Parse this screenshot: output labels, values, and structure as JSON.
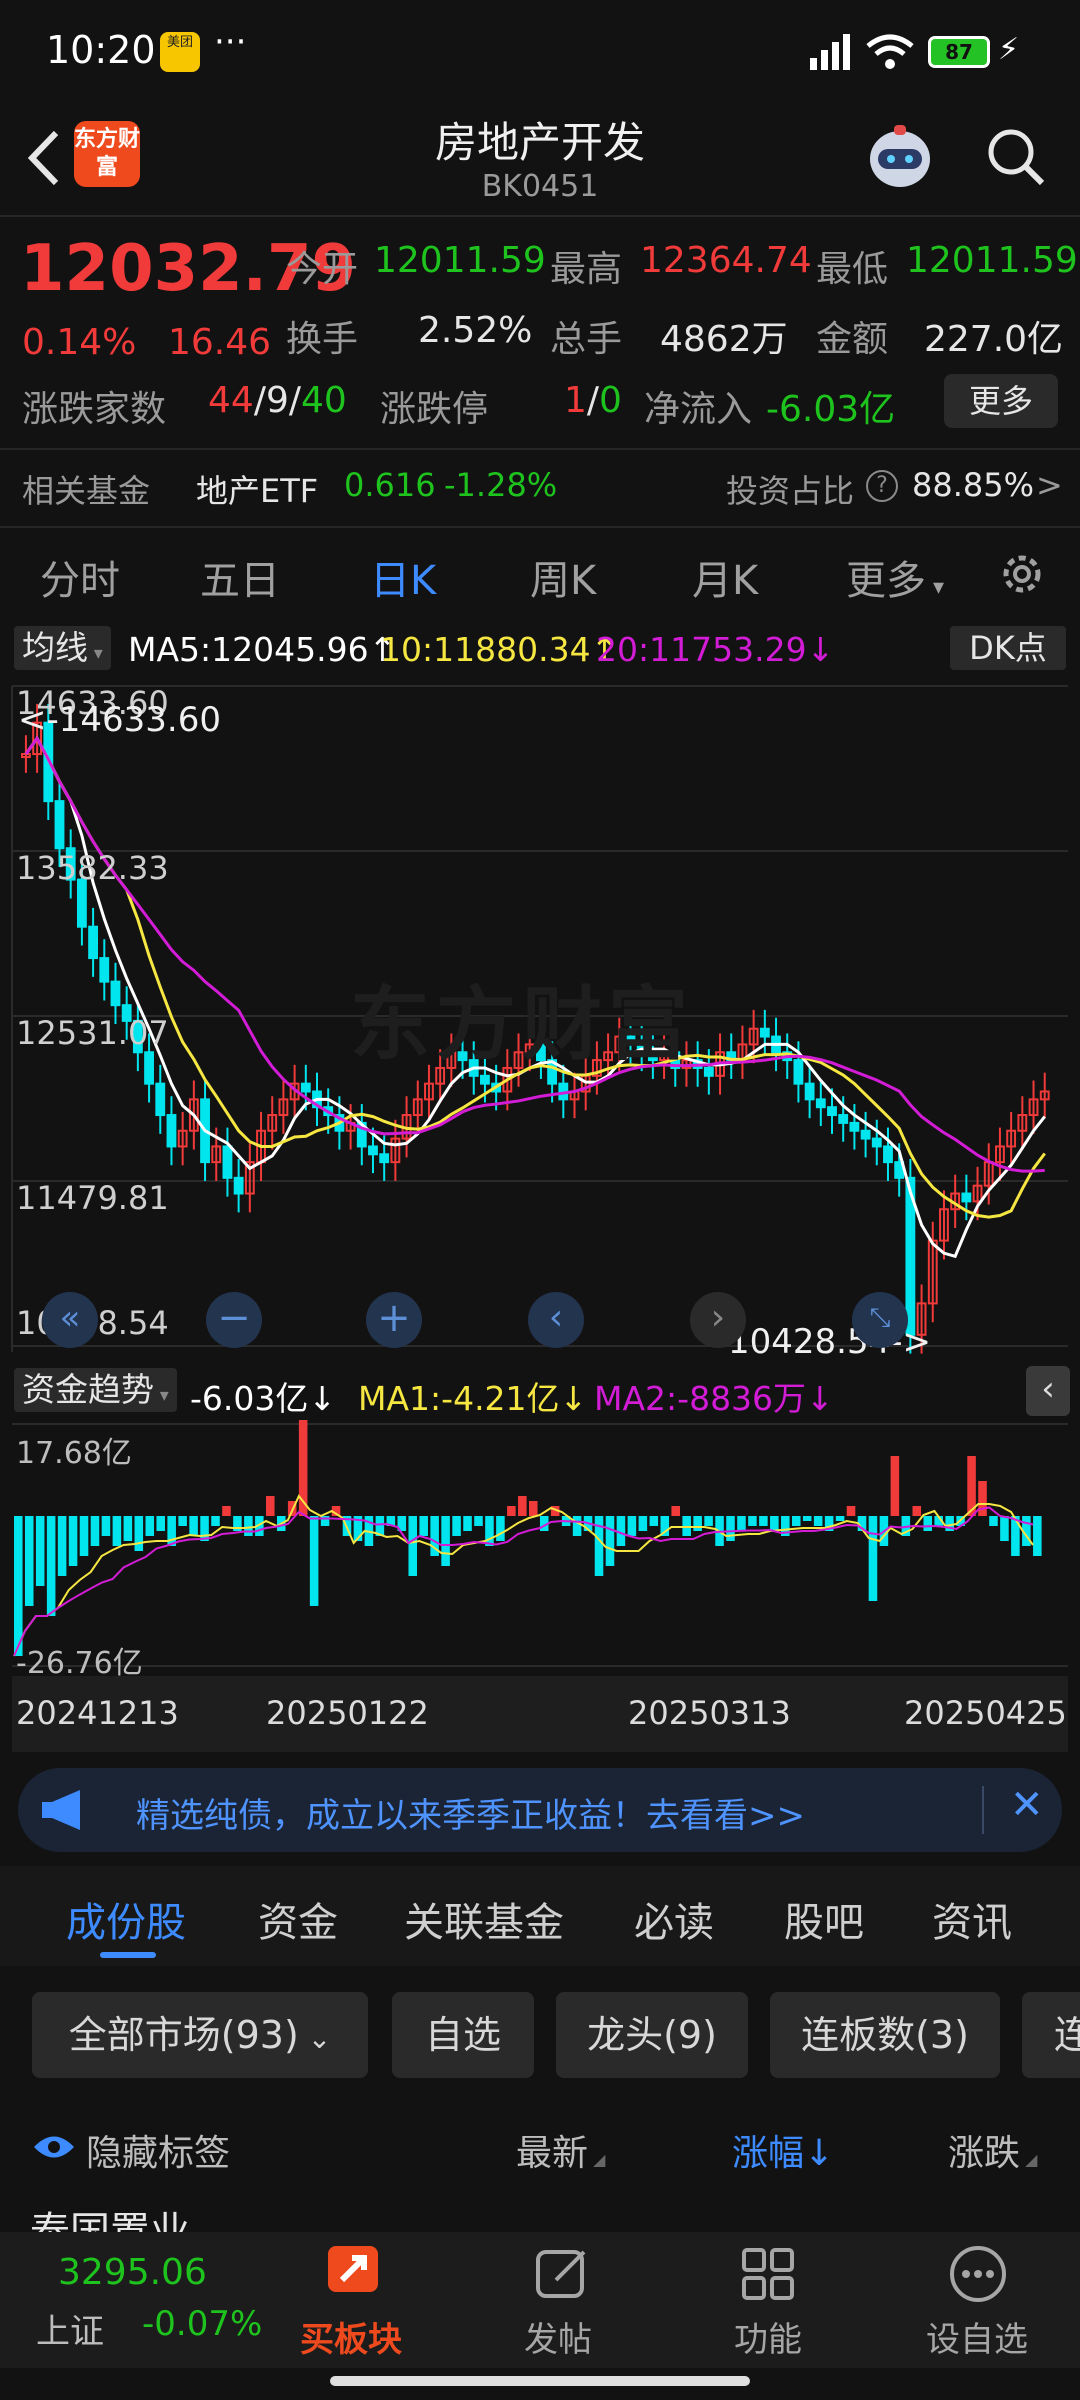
{
  "status": {
    "time": "10:20",
    "app_badge": "美团",
    "battery": "87",
    "dots": "···"
  },
  "header": {
    "title": "房地产开发",
    "code": "BK0451",
    "logo": "东方财富"
  },
  "quote": {
    "price": "12032.79",
    "pct": "0.14%",
    "chg": "16.46",
    "open_label": "今开",
    "open": "12011.59",
    "high_label": "最高",
    "high": "12364.74",
    "low_label": "最低",
    "low": "12011.59",
    "turn_label": "换手",
    "turn": "2.52%",
    "vol_label": "总手",
    "vol": "4862万",
    "amt_label": "金额",
    "amt": "227.0亿",
    "breadth_label": "涨跌家数",
    "up": "44",
    "flat": "9",
    "down": "40",
    "slash1": "/",
    "slash2": "/",
    "limit_label": "涨跌停",
    "limit_up": "1",
    "limit_down": "0",
    "slash3": "/",
    "flow_label": "净流入",
    "flow": "-6.03亿",
    "more": "更多"
  },
  "fund": {
    "label": "相关基金",
    "name": "地产ETF",
    "price": "0.616",
    "pct": "-1.28%",
    "ratio_label": "投资占比",
    "ratio": "88.85%",
    "help": "?",
    "chev": ">"
  },
  "period_tabs": [
    "分时",
    "五日",
    "日K",
    "周K",
    "月K",
    "更多"
  ],
  "ma": {
    "sel": "均线",
    "ma5": "MA5:12045.96↑",
    "ma10": "10:11880.34↑",
    "ma20": "20:11753.29↓",
    "dk": "DK点"
  },
  "kchart": {
    "y_labels": [
      "14633.60",
      "13582.33",
      "12531.07",
      "11479.81",
      "10428.54"
    ],
    "max_label": "<-14633.60",
    "min_label": "10428.54->",
    "watermark": "东方财富"
  },
  "flowbar": {
    "sel": "资金趋势",
    "value": "-6.03亿↓",
    "ma1": "MA1:-4.21亿↓",
    "ma2": "MA2:-8836万↓",
    "top": "17.68亿",
    "bottom": "-26.76亿"
  },
  "dates": [
    "20241213",
    "20250122",
    "20250313",
    "20250425"
  ],
  "banner": {
    "text": "精选纯债，成立以来季季正收益！去看看>>"
  },
  "info_tabs": [
    "成份股",
    "资金",
    "关联基金",
    "必读",
    "股吧",
    "资讯"
  ],
  "chips": [
    "全部市场(93)",
    "自选",
    "龙头(9)",
    "连板数(3)",
    "连"
  ],
  "list_header": {
    "hide": "隐藏标签",
    "latest": "最新",
    "pct": "涨幅↓",
    "chg": "涨跌"
  },
  "partial_row": "泰国置业",
  "bottom": {
    "index_name": "上证",
    "index_val": "3295.06",
    "index_pct": "-0.07%",
    "buy": "买板块",
    "post": "发帖",
    "func": "功能",
    "fav": "设自选"
  },
  "colors": {
    "up": "#f13a3a",
    "down": "#1ec31e",
    "cyan": "#00e5ee",
    "ma5": "#ffffff",
    "ma10": "#f5e642",
    "ma20": "#d21cd6",
    "accent": "#3d8bff"
  }
}
